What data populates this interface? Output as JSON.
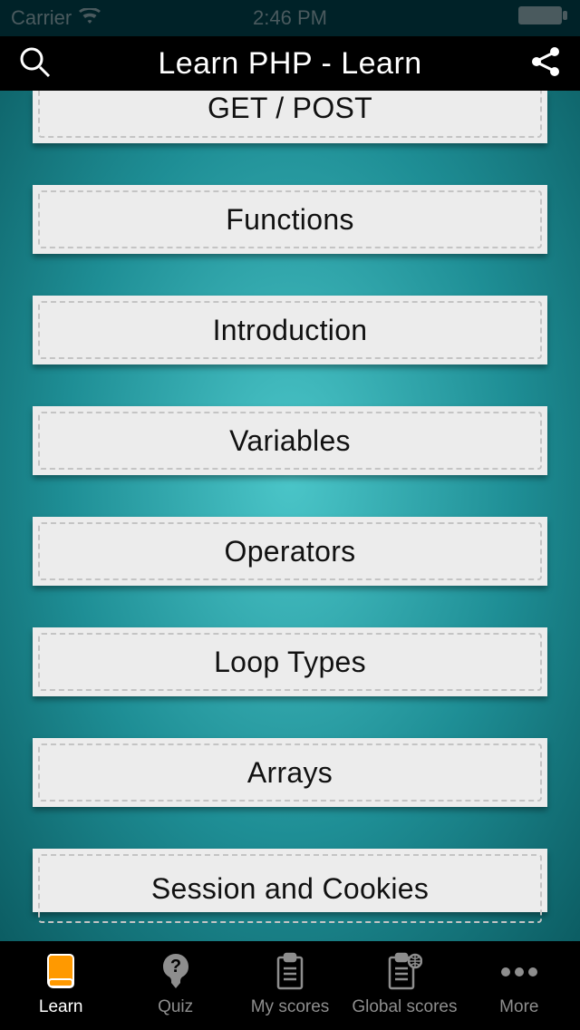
{
  "status": {
    "carrier": "Carrier",
    "time": "2:46 PM"
  },
  "header": {
    "title": "Learn PHP - Learn"
  },
  "topics": [
    "GET / POST",
    "Functions",
    "Introduction",
    "Variables",
    "Operators",
    "Loop Types",
    "Arrays",
    "Session and Cookies"
  ],
  "tabs": {
    "learn": "Learn",
    "quiz": "Quiz",
    "myscores": "My scores",
    "globalscores": "Global scores",
    "more": "More"
  }
}
